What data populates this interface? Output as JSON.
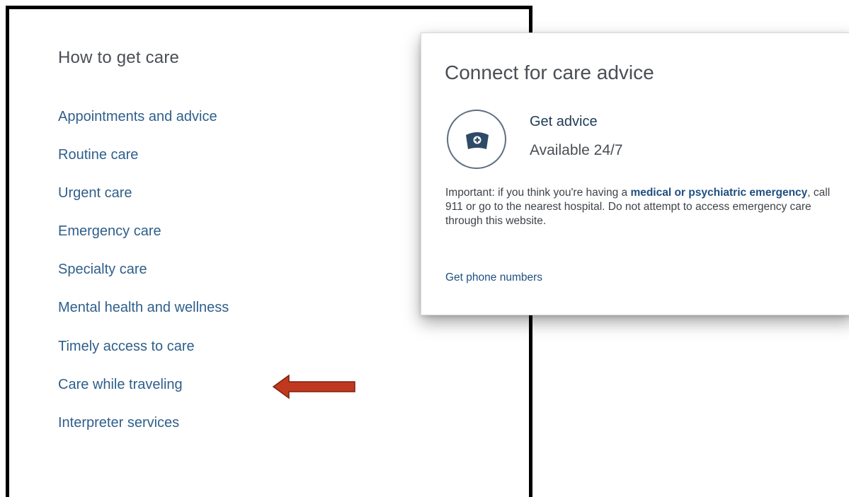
{
  "menu": {
    "title": "How to get care",
    "items": [
      {
        "label": "Appointments and advice"
      },
      {
        "label": "Routine care"
      },
      {
        "label": "Urgent care"
      },
      {
        "label": "Emergency care"
      },
      {
        "label": "Specialty care"
      },
      {
        "label": "Mental health and wellness"
      },
      {
        "label": "Timely access to care"
      },
      {
        "label": "Care while traveling"
      },
      {
        "label": "Interpreter services"
      }
    ]
  },
  "card": {
    "title": "Connect for care advice",
    "advice_icon": "nurse-cap-icon",
    "advice_label": "Get advice",
    "availability": "Available 24/7",
    "notice_prefix": "Important: if you think you're having a ",
    "notice_link": "medical or psychiatric emergency",
    "notice_suffix": ", call 911 or go to the nearest hospital. Do not attempt to access emergency care through this website.",
    "phone_link": "Get phone numbers"
  },
  "annotation": {
    "arrow_icon": "left-arrow-icon",
    "color": "#c0391f"
  },
  "colors": {
    "link": "#2f5f8a",
    "heading": "#4a4f55",
    "dark_link": "#1f4f82"
  }
}
